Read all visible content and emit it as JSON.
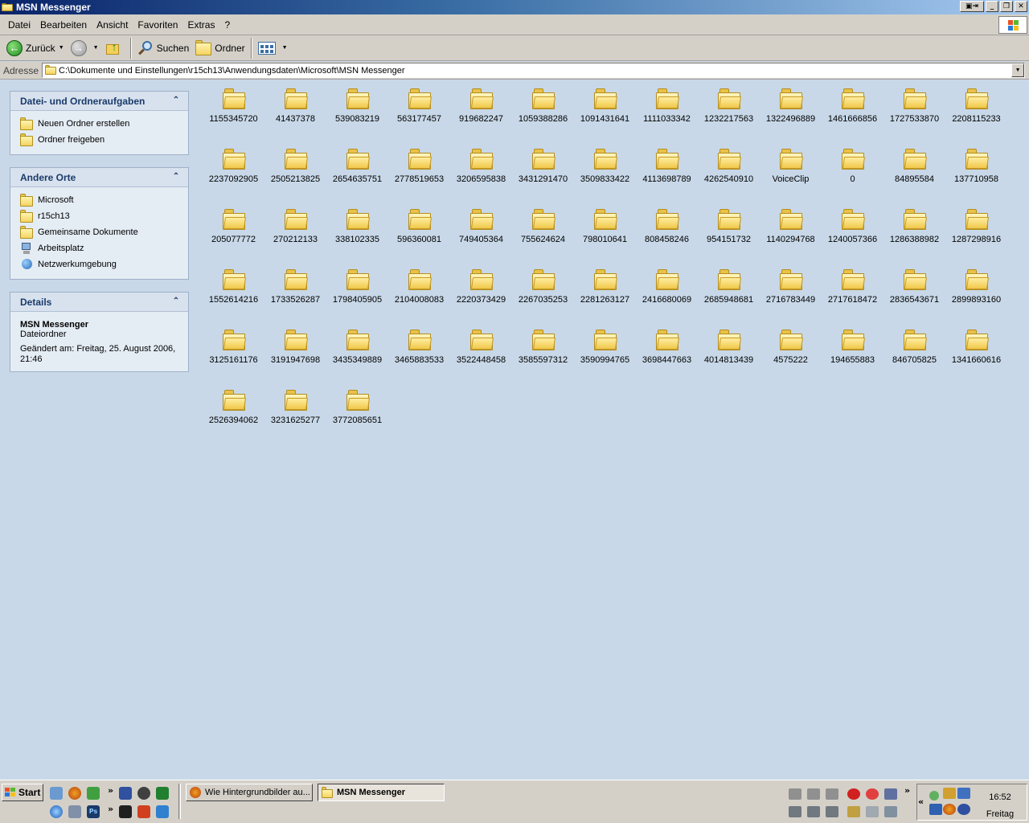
{
  "window": {
    "title": "MSN Messenger"
  },
  "menu": [
    "Datei",
    "Bearbeiten",
    "Ansicht",
    "Favoriten",
    "Extras",
    "?"
  ],
  "toolbar": {
    "back_label": "Zurück",
    "search_label": "Suchen",
    "folders_label": "Ordner"
  },
  "address": {
    "label": "Adresse",
    "value": "C:\\Dokumente und Einstellungen\\r15ch13\\Anwendungsdaten\\Microsoft\\MSN Messenger"
  },
  "panels": {
    "tasks": {
      "title": "Datei- und Ordneraufgaben",
      "items": [
        "Neuen Ordner erstellen",
        "Ordner freigeben"
      ]
    },
    "places": {
      "title": "Andere Orte",
      "items": [
        "Microsoft",
        "r15ch13",
        "Gemeinsame Dokumente",
        "Arbeitsplatz",
        "Netzwerkumgebung"
      ]
    },
    "details": {
      "title": "Details",
      "name": "MSN Messenger",
      "type": "Dateiordner",
      "modified_line1": "Geändert am: Freitag, 25. August 2006,",
      "modified_line2": "21:46"
    }
  },
  "folders": [
    "1155345720",
    "41437378",
    "539083219",
    "563177457",
    "919682247",
    "1059388286",
    "1091431641",
    "1111033342",
    "1232217563",
    "1322496889",
    "1461666856",
    "1727533870",
    "2208115233",
    "2237092905",
    "2505213825",
    "2654635751",
    "2778519653",
    "3206595838",
    "3431291470",
    "3509833422",
    "4113698789",
    "4262540910",
    "VoiceClip",
    "0",
    "84895584",
    "137710958",
    "205077772",
    "270212133",
    "338102335",
    "596360081",
    "749405364",
    "755624624",
    "798010641",
    "808458246",
    "954151732",
    "1140294768",
    "1240057366",
    "1286388982",
    "1287298916",
    "1552614216",
    "1733526287",
    "1798405905",
    "2104008083",
    "2220373429",
    "2267035253",
    "2281263127",
    "2416680069",
    "2685948681",
    "2716783449",
    "2717618472",
    "2836543671",
    "2899893160",
    "3125161176",
    "3191947698",
    "3435349889",
    "3465883533",
    "3522448458",
    "3585597312",
    "3590994765",
    "3698447663",
    "4014813439",
    "4575222",
    "194655883",
    "846705825",
    "1341660616",
    "2526394062",
    "3231625277",
    "3772085651"
  ],
  "taskbar": {
    "start_label": "Start",
    "tasks": [
      {
        "label": "Wie Hintergrundbilder au...",
        "active": false
      },
      {
        "label": "MSN Messenger",
        "active": true
      }
    ],
    "clock": "16:52",
    "day": "Freitag"
  },
  "colors": {
    "titlebar_start": "#0a246a",
    "panel_bg": "#e4ecf4",
    "content_bg": "#c8d8e8",
    "folder": "#f3d15a"
  }
}
